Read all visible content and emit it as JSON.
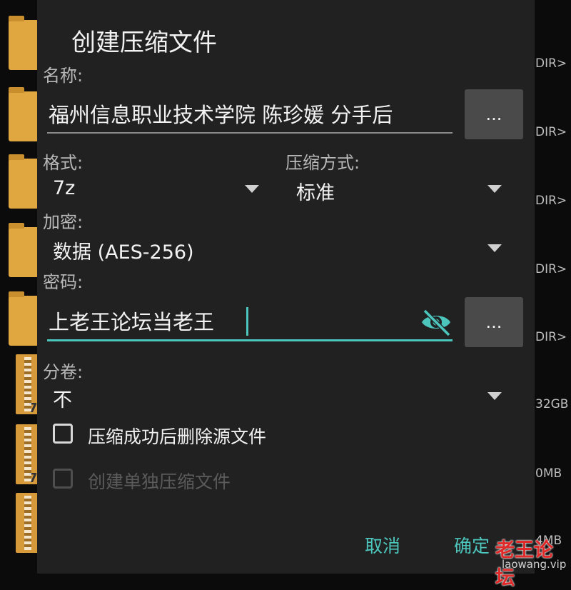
{
  "background": {
    "right_labels": [
      "DIR>",
      "DIR>",
      "DIR>",
      "DIR>",
      "DIR>",
      "32GB",
      "0MB",
      "4MB"
    ],
    "archive_labels": [
      "7",
      "7"
    ]
  },
  "dialog": {
    "title": "创建压缩文件",
    "name_label": "名称:",
    "name_value": "福州信息职业技术学院 陈珍媛 分手后",
    "browse_label": "...",
    "format_label": "格式:",
    "format_value": "7z",
    "method_label": "压缩方式:",
    "method_value": "标准",
    "encrypt_label": "加密:",
    "encrypt_value": "数据 (AES-256)",
    "password_label": "密码:",
    "password_value": "上老王论坛当老王",
    "password_more_label": "...",
    "split_label": "分卷:",
    "split_value": "不",
    "delete_source_label": "压缩成功后删除源文件",
    "separate_archives_label": "创建单独压缩文件",
    "cancel_label": "取消",
    "ok_label": "确定"
  },
  "watermark": {
    "text": "老王论坛",
    "url": "laowang.vip"
  },
  "colors": {
    "accent": "#4cc6bd",
    "dialog_bg": "#212121",
    "folder": "#e0a63f"
  }
}
